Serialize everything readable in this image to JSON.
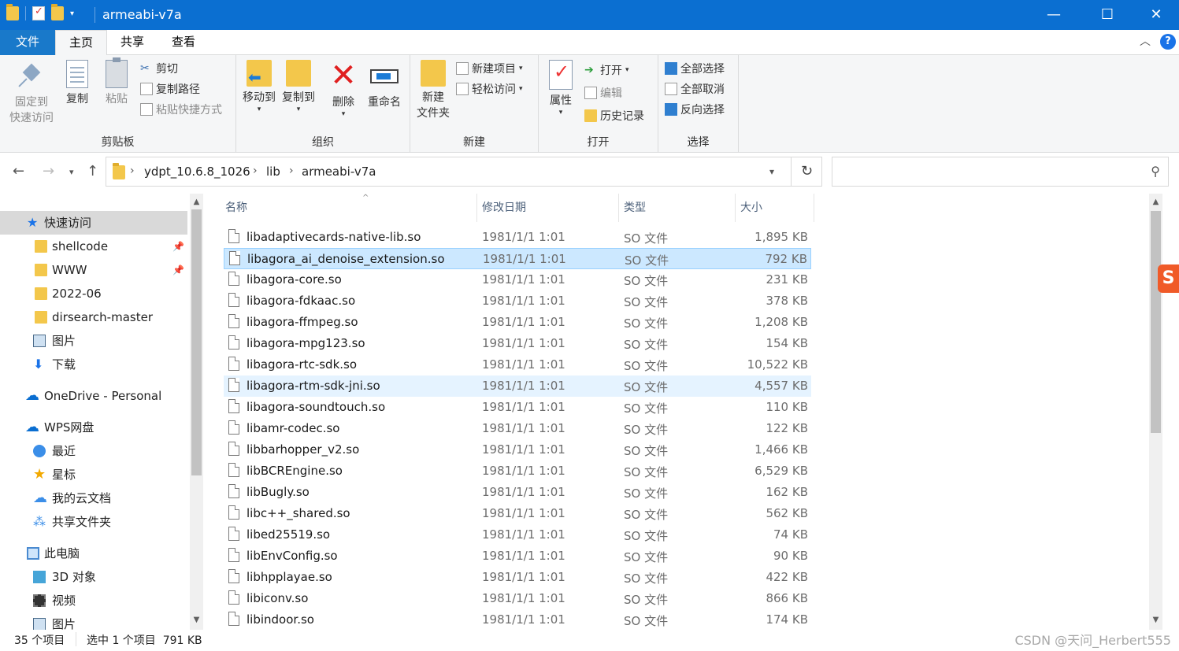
{
  "window": {
    "title": "armeabi-v7a",
    "minimize": "—",
    "maximize": "☐",
    "close": "✕"
  },
  "tabs": {
    "file": "文件",
    "home": "主页",
    "share": "共享",
    "view": "查看",
    "help": "?"
  },
  "ribbon": {
    "clipboard": {
      "label": "剪贴板",
      "pin_line1": "固定到",
      "pin_line2": "快速访问",
      "copy": "复制",
      "paste": "粘贴",
      "cut": "剪切",
      "copy_path": "复制路径",
      "paste_shortcut": "粘贴快捷方式"
    },
    "organize": {
      "label": "组织",
      "move_to": "移动到",
      "copy_to": "复制到",
      "delete": "删除",
      "rename": "重命名"
    },
    "new": {
      "label": "新建",
      "new_folder_line1": "新建",
      "new_folder_line2": "文件夹",
      "new_item": "新建项目",
      "easy_access": "轻松访问"
    },
    "open": {
      "label": "打开",
      "properties": "属性",
      "open": "打开",
      "edit": "编辑",
      "history": "历史记录"
    },
    "select": {
      "label": "选择",
      "select_all": "全部选择",
      "select_none": "全部取消",
      "invert": "反向选择"
    }
  },
  "address": {
    "crumbs": [
      "ydpt_10.6.8_1026",
      "lib",
      "armeabi-v7a"
    ],
    "search_placeholder": ""
  },
  "sidebar": {
    "items": [
      {
        "label": "快速访问",
        "icon": "star-icon"
      },
      {
        "label": "shellcode",
        "icon": "folder-icon",
        "pinned": true
      },
      {
        "label": "WWW",
        "icon": "folder-icon",
        "pinned": true
      },
      {
        "label": "2022-06",
        "icon": "folder-icon"
      },
      {
        "label": "dirsearch-master",
        "icon": "folder-icon"
      },
      {
        "label": "图片",
        "icon": "pictures-icon"
      },
      {
        "label": "下载",
        "icon": "download-icon"
      },
      {
        "label": "OneDrive - Personal",
        "icon": "cloud-icon"
      },
      {
        "label": "WPS网盘",
        "icon": "cloud-icon"
      },
      {
        "label": "最近",
        "icon": "clock-icon"
      },
      {
        "label": "星标",
        "icon": "star-icon"
      },
      {
        "label": "我的云文档",
        "icon": "cloud-icon"
      },
      {
        "label": "共享文件夹",
        "icon": "share-icon"
      },
      {
        "label": "此电脑",
        "icon": "computer-icon"
      },
      {
        "label": "3D 对象",
        "icon": "3d-objects-icon"
      },
      {
        "label": "视频",
        "icon": "video-icon"
      },
      {
        "label": "图片",
        "icon": "pictures-icon"
      }
    ]
  },
  "columns": {
    "name": "名称",
    "date": "修改日期",
    "type": "类型",
    "size": "大小"
  },
  "files": [
    {
      "name": "libadaptivecards-native-lib.so",
      "date": "1981/1/1 1:01",
      "type": "SO 文件",
      "size": "1,895 KB"
    },
    {
      "name": "libagora_ai_denoise_extension.so",
      "date": "1981/1/1 1:01",
      "type": "SO 文件",
      "size": "792 KB",
      "selected": true
    },
    {
      "name": "libagora-core.so",
      "date": "1981/1/1 1:01",
      "type": "SO 文件",
      "size": "231 KB"
    },
    {
      "name": "libagora-fdkaac.so",
      "date": "1981/1/1 1:01",
      "type": "SO 文件",
      "size": "378 KB"
    },
    {
      "name": "libagora-ffmpeg.so",
      "date": "1981/1/1 1:01",
      "type": "SO 文件",
      "size": "1,208 KB"
    },
    {
      "name": "libagora-mpg123.so",
      "date": "1981/1/1 1:01",
      "type": "SO 文件",
      "size": "154 KB"
    },
    {
      "name": "libagora-rtc-sdk.so",
      "date": "1981/1/1 1:01",
      "type": "SO 文件",
      "size": "10,522 KB"
    },
    {
      "name": "libagora-rtm-sdk-jni.so",
      "date": "1981/1/1 1:01",
      "type": "SO 文件",
      "size": "4,557 KB",
      "hover": true
    },
    {
      "name": "libagora-soundtouch.so",
      "date": "1981/1/1 1:01",
      "type": "SO 文件",
      "size": "110 KB"
    },
    {
      "name": "libamr-codec.so",
      "date": "1981/1/1 1:01",
      "type": "SO 文件",
      "size": "122 KB"
    },
    {
      "name": "libbarhopper_v2.so",
      "date": "1981/1/1 1:01",
      "type": "SO 文件",
      "size": "1,466 KB"
    },
    {
      "name": "libBCREngine.so",
      "date": "1981/1/1 1:01",
      "type": "SO 文件",
      "size": "6,529 KB"
    },
    {
      "name": "libBugly.so",
      "date": "1981/1/1 1:01",
      "type": "SO 文件",
      "size": "162 KB"
    },
    {
      "name": "libc++_shared.so",
      "date": "1981/1/1 1:01",
      "type": "SO 文件",
      "size": "562 KB"
    },
    {
      "name": "libed25519.so",
      "date": "1981/1/1 1:01",
      "type": "SO 文件",
      "size": "74 KB"
    },
    {
      "name": "libEnvConfig.so",
      "date": "1981/1/1 1:01",
      "type": "SO 文件",
      "size": "90 KB"
    },
    {
      "name": "libhpplayae.so",
      "date": "1981/1/1 1:01",
      "type": "SO 文件",
      "size": "422 KB"
    },
    {
      "name": "libiconv.so",
      "date": "1981/1/1 1:01",
      "type": "SO 文件",
      "size": "866 KB"
    },
    {
      "name": "libindoor.so",
      "date": "1981/1/1 1:01",
      "type": "SO 文件",
      "size": "174 KB"
    }
  ],
  "status": {
    "count": "35 个项目",
    "selection": "选中 1 个项目  791 KB"
  },
  "watermark": "CSDN @天问_Herbert555",
  "ime_badge": "S"
}
